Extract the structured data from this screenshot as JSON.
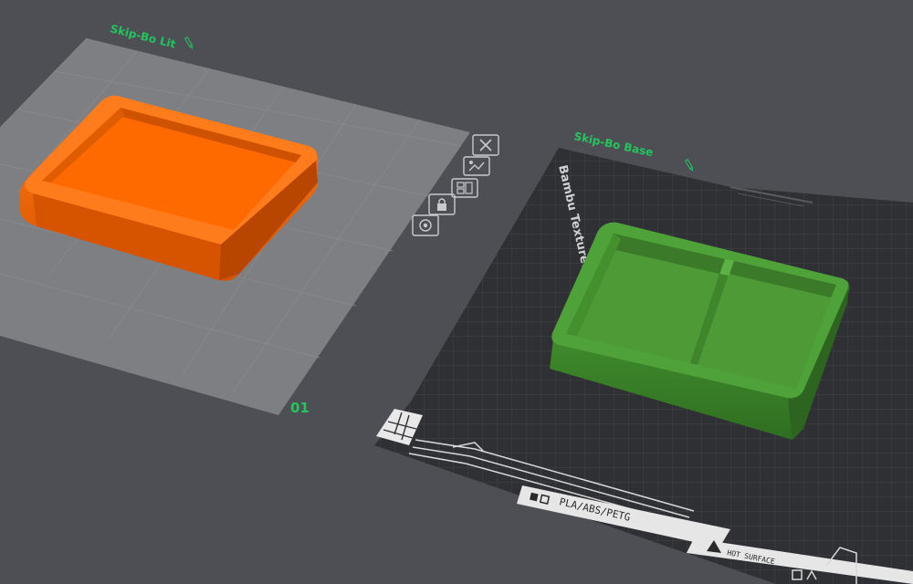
{
  "scene": {
    "background_color": "#4d4f54"
  },
  "plates": [
    {
      "name": "Skip-Bo Lit",
      "index_label": "01",
      "edit_icon": "pencil-icon",
      "plate_color": "#7d7f83",
      "object_color": "#ff6a00"
    },
    {
      "name": "Skip-Bo Base",
      "plate_type_label": "Bambu Textured PEI Plate",
      "material_label": "PLA/ABS/PETG",
      "hot_surface_label": "HOT SURFACE",
      "edit_icon": "pencil-icon",
      "plate_color": "#2f3033",
      "object_color": "#4d9a36"
    }
  ],
  "plate_toolbar": [
    {
      "icon": "close-icon"
    },
    {
      "icon": "auto-orient-icon"
    },
    {
      "icon": "arrange-icon"
    },
    {
      "icon": "lock-icon"
    },
    {
      "icon": "settings-icon"
    }
  ],
  "label_color": "#22c55e"
}
